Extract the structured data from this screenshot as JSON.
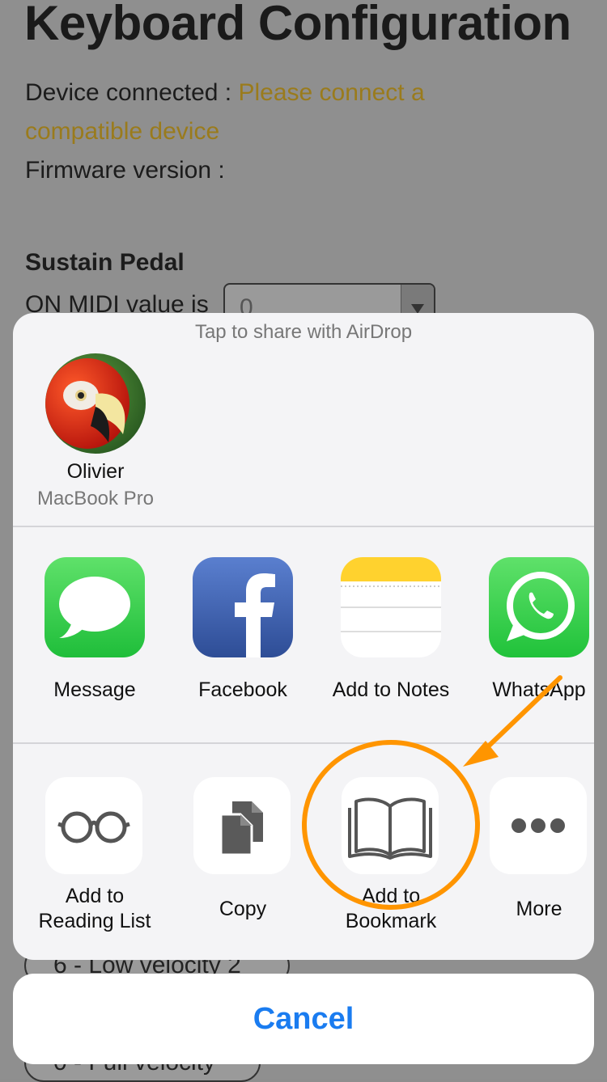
{
  "page": {
    "title": "Keyboard Configuration",
    "device_label": "Device connected : ",
    "device_status_line1": "Please connect a",
    "device_status_line2": "compatible device",
    "firmware_label": "Firmware version :",
    "sustain_heading": "Sustain Pedal",
    "on_midi_label": "ON MIDI value is",
    "on_midi_value": "0",
    "velocity_option_6": "6 - Low velocity 2",
    "velocity_option_full": "0 - Full velocity"
  },
  "share_sheet": {
    "airdrop_title": "Tap to share with AirDrop",
    "contact": {
      "name": "Olivier",
      "device": "MacBook Pro"
    },
    "apps": [
      {
        "label": "Message",
        "icon": "message-icon",
        "color": "#33c94a"
      },
      {
        "label": "Facebook",
        "icon": "facebook-icon",
        "color": "#3b5998"
      },
      {
        "label": "Add to Notes",
        "icon": "notes-icon",
        "color": "#ffd22e"
      },
      {
        "label": "WhatsApp",
        "icon": "whatsapp-icon",
        "color": "#25d366"
      }
    ],
    "actions": [
      {
        "label_line1": "Add to",
        "label_line2": "Reading List",
        "icon": "glasses-icon"
      },
      {
        "label": "Copy",
        "icon": "copy-icon"
      },
      {
        "label_line1": "Add to",
        "label_line2": "Bookmark",
        "icon": "book-icon"
      },
      {
        "label": "More",
        "icon": "more-dots-icon"
      }
    ],
    "cancel_label": "Cancel"
  },
  "colors": {
    "annotation_orange": "#ff9500",
    "accent_blue": "#1a7cf0",
    "warning_text": "#9a7b1c"
  }
}
